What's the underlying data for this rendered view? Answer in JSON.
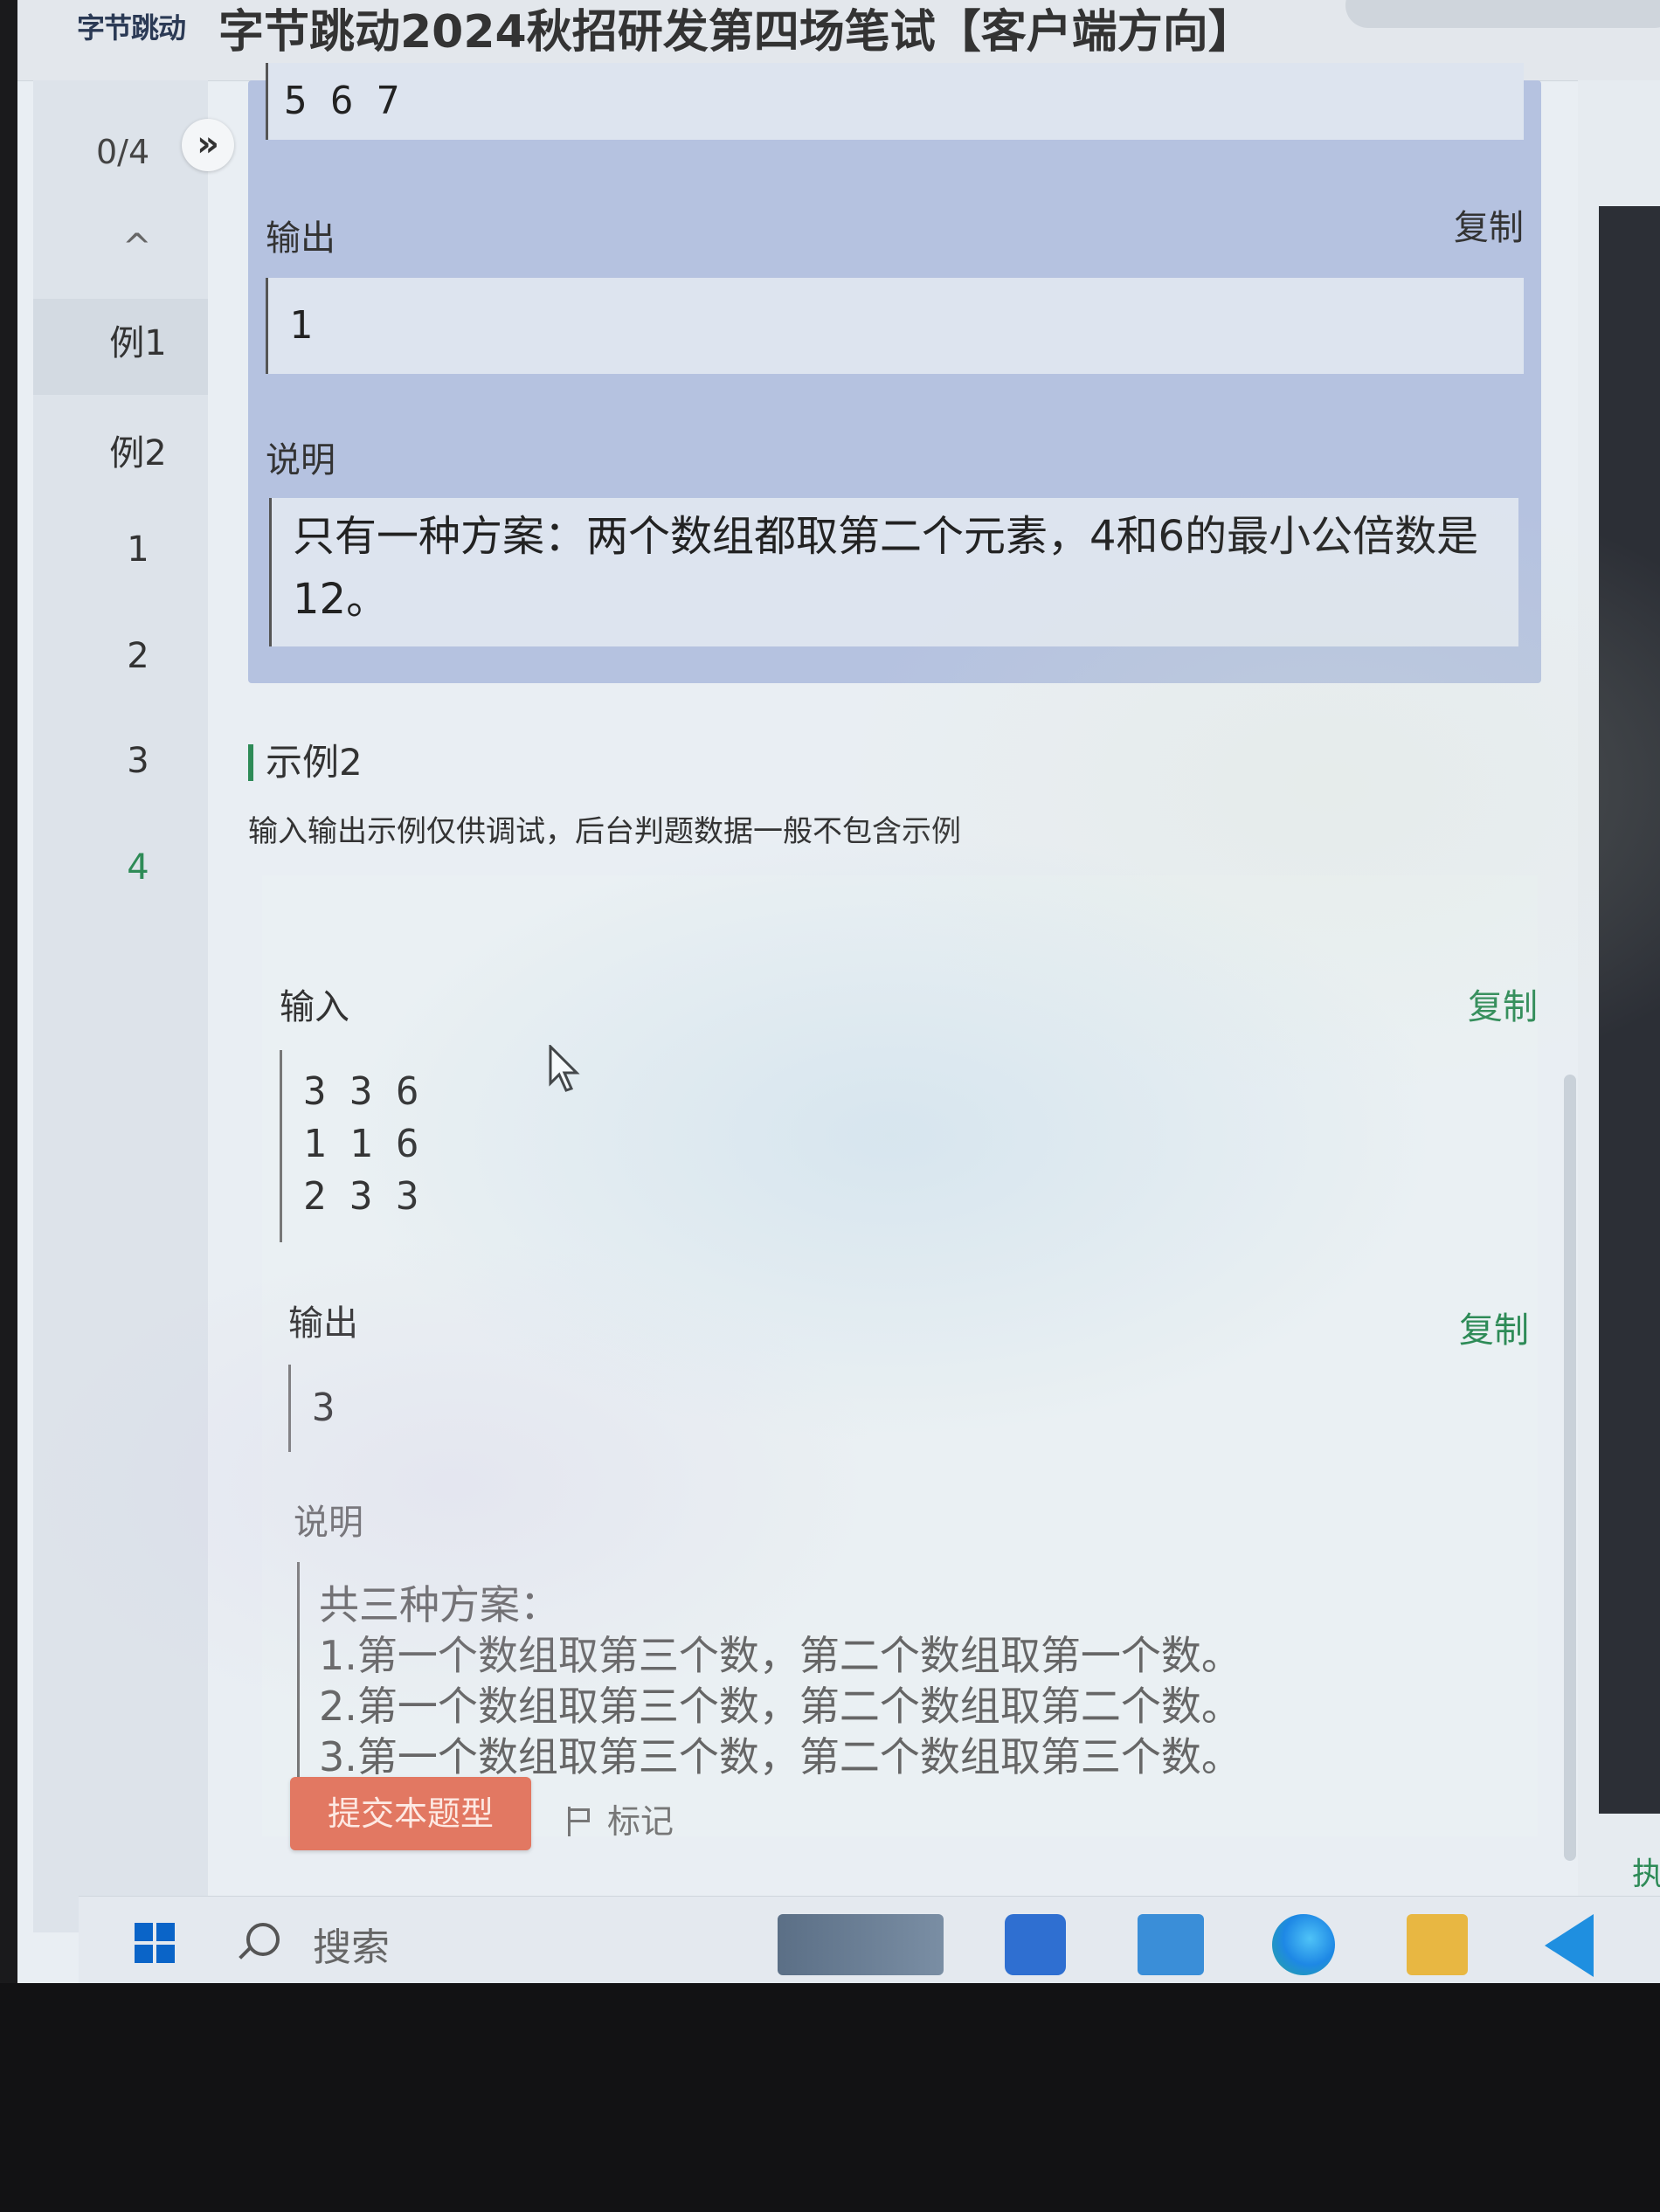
{
  "header": {
    "logo_text": "字节跳动",
    "exam_title": "字节跳动2024秋招研发第四场笔试【客户端方向】"
  },
  "sidebar": {
    "progress": "0/4",
    "collapse_symbol": "»",
    "up_symbol": "^",
    "items": [
      {
        "label": "例1"
      },
      {
        "label": "例2"
      },
      {
        "label": "1"
      },
      {
        "label": "2"
      },
      {
        "label": "3"
      },
      {
        "label": "4"
      }
    ]
  },
  "example1": {
    "input_tail": "5 6 7",
    "output_label": "输出",
    "copy_label": "复制",
    "output_value": "1",
    "explain_label": "说明",
    "explain_line1": "只有一种方案：两个数组都取第二个元素，4和6的最小公倍数是",
    "explain_line2": "12。"
  },
  "example2": {
    "title": "示例2",
    "note": "输入输出示例仅供调试，后台判题数据一般不包含示例",
    "input_label": "输入",
    "input_copy": "复制",
    "input_lines": [
      "3 3 6",
      "1 1 6",
      "2 3 3"
    ],
    "output_label": "输出",
    "output_copy": "复制",
    "output_value": "3",
    "explain_label": "说明",
    "explain_lines": [
      "共三种方案：",
      "1.第一个数组取第三个数，第二个数组取第一个数。",
      "2.第一个数组取第三个数，第二个数组取第二个数。",
      "3.第一个数组取第三个数，第二个数组取第三个数。"
    ]
  },
  "actions": {
    "submit_label": "提交本题型",
    "mark_label": "标记"
  },
  "right_panel": {
    "run_label": "执"
  },
  "taskbar": {
    "search_label": "搜索",
    "apps": [
      "widgets-icon",
      "store-icon",
      "mail-icon",
      "edge-icon",
      "folder-icon",
      "vscode-icon"
    ]
  },
  "colors": {
    "accent": "#2e8b57",
    "submit": "#e27862",
    "highlight_box": "#b5c2e0"
  }
}
